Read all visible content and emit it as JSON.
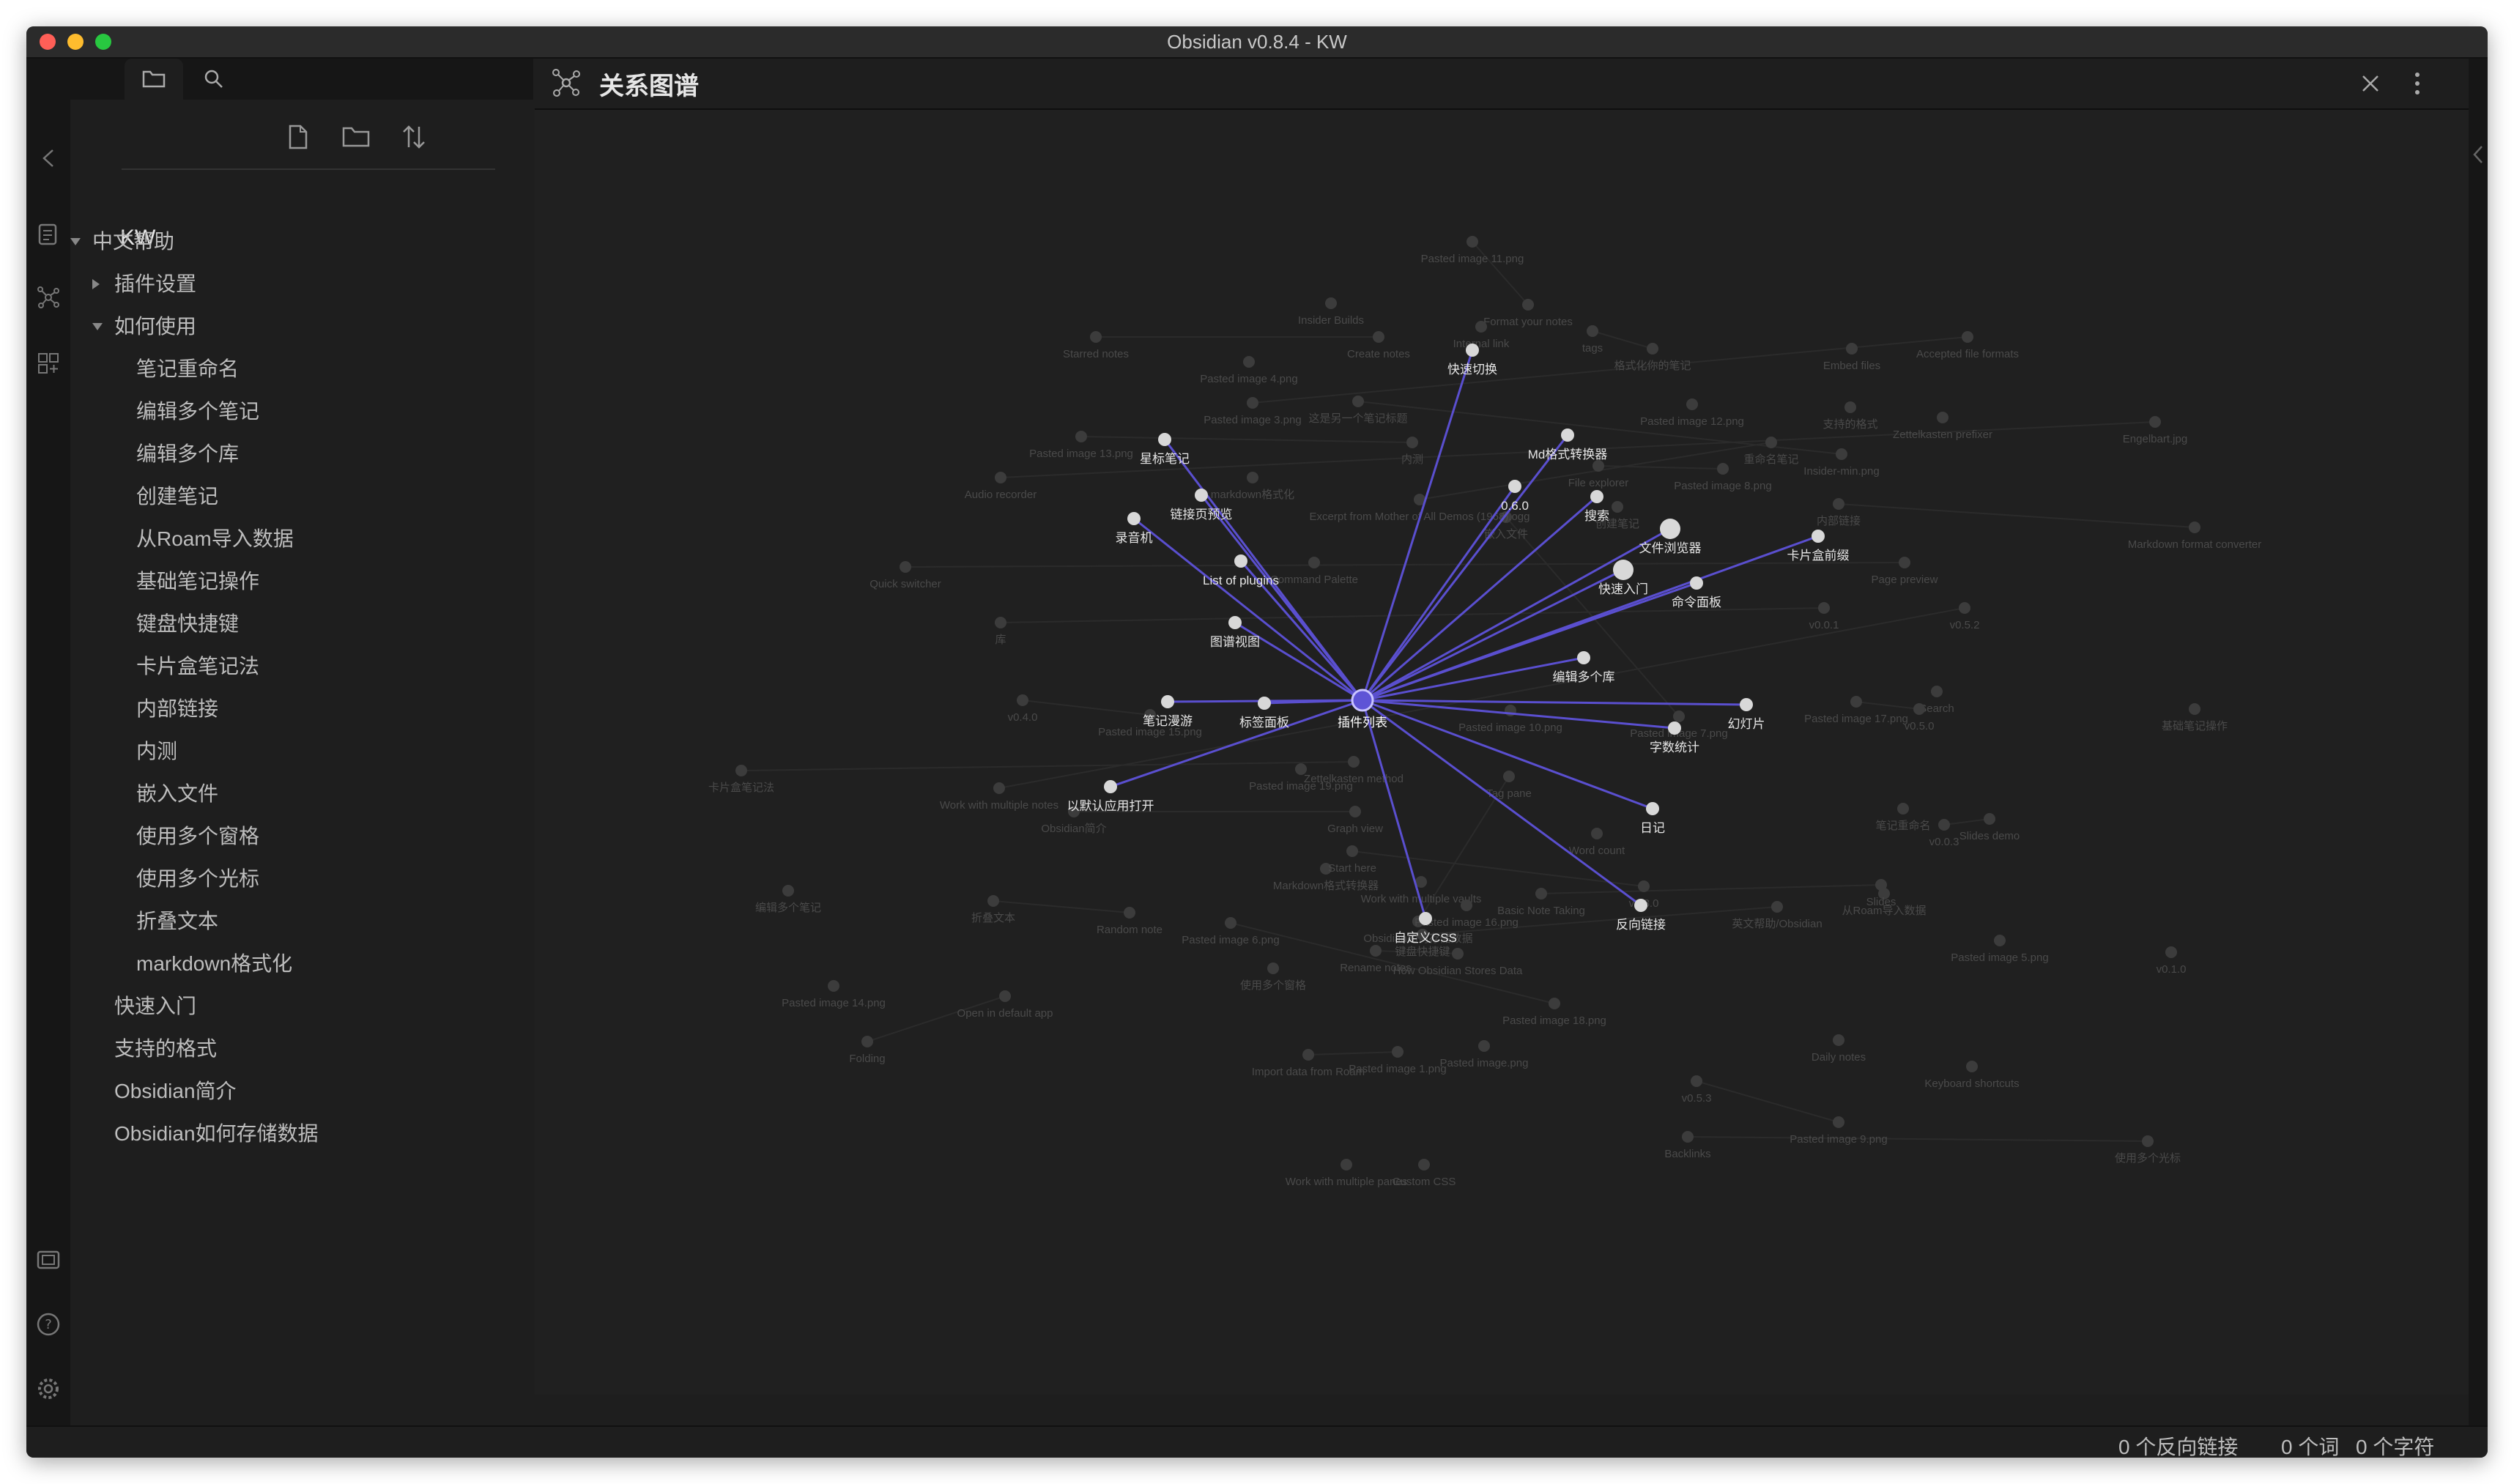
{
  "window": {
    "title": "Obsidian v0.8.4 - KW"
  },
  "traffic_lights": {
    "close": "#ff5f57",
    "minimize": "#febc2e",
    "zoom": "#28c840"
  },
  "ribbon": {
    "icons": [
      "chevron-left-icon",
      "file-list-icon",
      "graph-icon",
      "grid-plus-icon",
      "screenshot-icon",
      "help-icon",
      "settings-icon"
    ]
  },
  "sidebar": {
    "tabs": [
      "folder-icon",
      "search-icon"
    ],
    "actions": [
      "new-note-icon",
      "new-folder-icon",
      "sort-icon"
    ],
    "vault": "KW",
    "items": [
      {
        "label": "中文帮助",
        "level": 0,
        "type": "folder-open"
      },
      {
        "label": "插件设置",
        "level": 1,
        "type": "folder-closed"
      },
      {
        "label": "如何使用",
        "level": 1,
        "type": "folder-open"
      },
      {
        "label": "笔记重命名",
        "level": 2,
        "type": "file"
      },
      {
        "label": "编辑多个笔记",
        "level": 2,
        "type": "file"
      },
      {
        "label": "编辑多个库",
        "level": 2,
        "type": "file"
      },
      {
        "label": "创建笔记",
        "level": 2,
        "type": "file"
      },
      {
        "label": "从Roam导入数据",
        "level": 2,
        "type": "file"
      },
      {
        "label": "基础笔记操作",
        "level": 2,
        "type": "file"
      },
      {
        "label": "键盘快捷键",
        "level": 2,
        "type": "file"
      },
      {
        "label": "卡片盒笔记法",
        "level": 2,
        "type": "file"
      },
      {
        "label": "内部链接",
        "level": 2,
        "type": "file"
      },
      {
        "label": "内测",
        "level": 2,
        "type": "file"
      },
      {
        "label": "嵌入文件",
        "level": 2,
        "type": "file"
      },
      {
        "label": "使用多个窗格",
        "level": 2,
        "type": "file"
      },
      {
        "label": "使用多个光标",
        "level": 2,
        "type": "file"
      },
      {
        "label": "折叠文本",
        "level": 2,
        "type": "file"
      },
      {
        "label": "markdown格式化",
        "level": 2,
        "type": "file"
      },
      {
        "label": "快速入门",
        "level": 1,
        "type": "file"
      },
      {
        "label": "支持的格式",
        "level": 1,
        "type": "file"
      },
      {
        "label": "Obsidian简介",
        "level": 1,
        "type": "file"
      },
      {
        "label": "Obsidian如何存储数据",
        "level": 1,
        "type": "file"
      }
    ]
  },
  "view": {
    "title": "关系图谱",
    "icons": [
      "graph-icon",
      "close-icon",
      "more-options-icon"
    ]
  },
  "graph": {
    "edge_color": "#5a4fcf",
    "center": {
      "label": "插件列表"
    },
    "linked": [
      "快速切换",
      "星标笔记",
      "Md格式转换器",
      "0.6.0",
      "搜索",
      "卡片盒前缀",
      "链接页预览",
      "文件浏览器",
      "录音机",
      "List of plugins",
      "快速入门",
      "命令面板",
      "图谱视图",
      "编辑多个库",
      "笔记漫游",
      "标签面板",
      "幻灯片",
      "字数统计",
      "以默认应用打开",
      "日记",
      "反向链接",
      "自定义CSS"
    ],
    "faded": [
      "Pasted image 11.png",
      "Insider Builds",
      "Format your notes",
      "Starred notes",
      "Pasted image 4.png",
      "Create notes",
      "Internal link",
      "tags",
      "格式化你的笔记",
      "Embed files",
      "Accepted file formats",
      "Pasted image 3.png",
      "这是另一个笔记标题",
      "Pasted image 12.png",
      "支持的格式",
      "Pasted image 13.png",
      "内测",
      "重命名笔记",
      "Zettelkasten prefixer",
      "Engelbart.jpg",
      "Audio recorder",
      "markdown格式化",
      "File explorer",
      "Pasted image 8.png",
      "Insider-min.png",
      "创建笔记",
      "内部链接",
      "Markdown format converter",
      "嵌入文件",
      "Excerpt from Mother of All Demos (1968).ogg",
      "Page preview",
      "Quick switcher",
      "Command Palette",
      "库",
      "v0.0.1",
      "v0.5.2",
      "Search",
      "v0.4.0",
      "Pasted image 15.png",
      "Pasted image 10.png",
      "Pasted image 7.png",
      "Pasted image 17.png",
      "v0.5.0",
      "基础笔记操作",
      "卡片盒笔记法",
      "Zettelkasten method",
      "Pasted image 19.png",
      "Work with multiple notes",
      "Obsidian简介",
      "Graph view",
      "Tag pane",
      "笔记重命名",
      "v0.0.3",
      "Slides demo",
      "Word count",
      "Markdown格式转换器",
      "Start here",
      "v0.3.0",
      "从Roam导入数据",
      "Work with multiple vaults",
      "Basic Note Taking",
      "Slides",
      "Obsidian如何存储数据",
      "编辑多个笔记",
      "折叠文本",
      "Random note",
      "Pasted image 6.png",
      "Pasted image 16.png",
      "英文帮助/Obsidian",
      "键盘快捷键",
      "Pasted image 5.png",
      "Pasted image 14.png",
      "Rename notes",
      "How Obsidian Stores Data",
      "v0.1.0",
      "使用多个窗格",
      "Open in default app",
      "Folding",
      "Pasted image 18.png",
      "Daily notes",
      "Import data from Roam",
      "Pasted image 1.png",
      "Pasted image.png",
      "Keyboard shortcuts",
      "v0.5.3",
      "Pasted image 9.png",
      "使用多个光标",
      "Backlinks",
      "Work with multiple panes",
      "Custom CSS"
    ]
  },
  "status": {
    "backlinks": "0 个反向链接",
    "words": "0 个词",
    "chars": "0 个字符"
  }
}
